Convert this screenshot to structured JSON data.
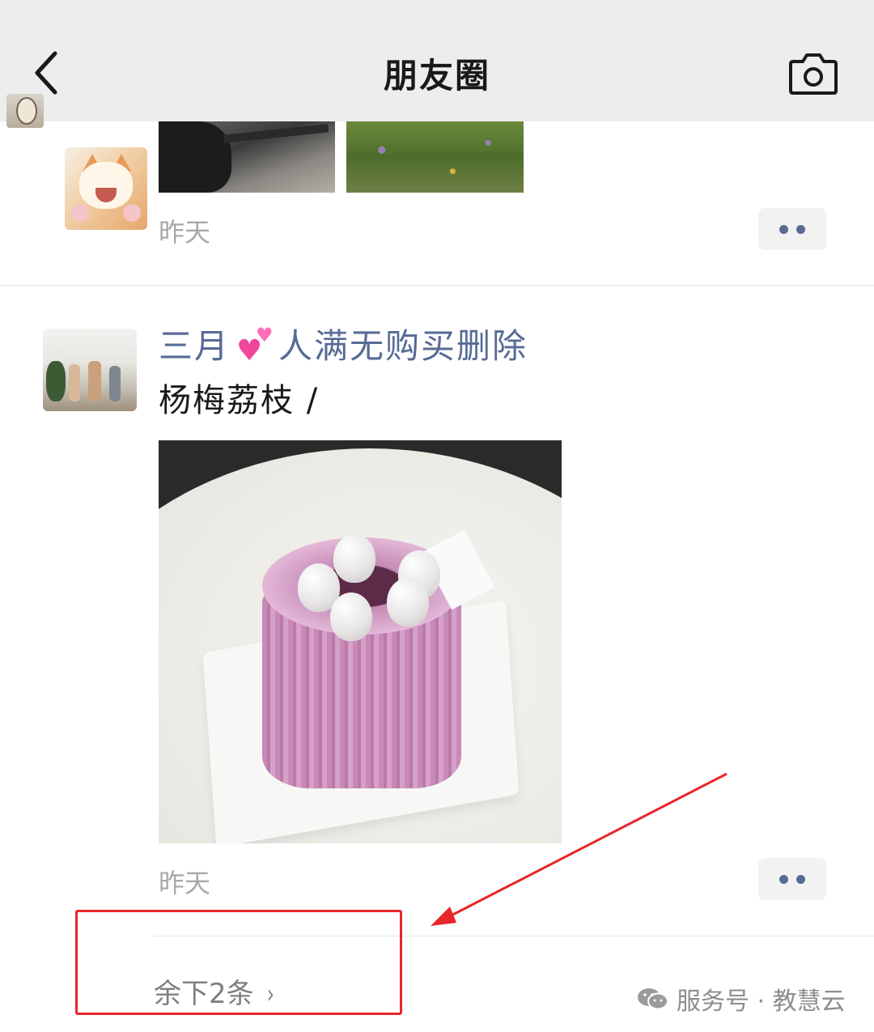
{
  "header": {
    "title": "朋友圈",
    "back_icon": "chevron-left-icon",
    "camera_icon": "camera-icon",
    "background": "#ededed"
  },
  "post_prev": {
    "time": "昨天",
    "more_icon": "more-dots-icon"
  },
  "post_main": {
    "username_part1": "三月",
    "emoji": "💕",
    "username_part2": "人满无购买删除",
    "text": "杨梅荔枝 /",
    "time": "昨天",
    "more_icon": "more-dots-icon"
  },
  "remaining": {
    "label": "余下2条",
    "chevron": "›"
  },
  "watermark": {
    "icon": "wechat-icon",
    "text": "服务号 · 教慧云"
  },
  "colors": {
    "username": "#576b95",
    "annotation": "#e8262a",
    "timestamp": "#a8a8a8"
  }
}
